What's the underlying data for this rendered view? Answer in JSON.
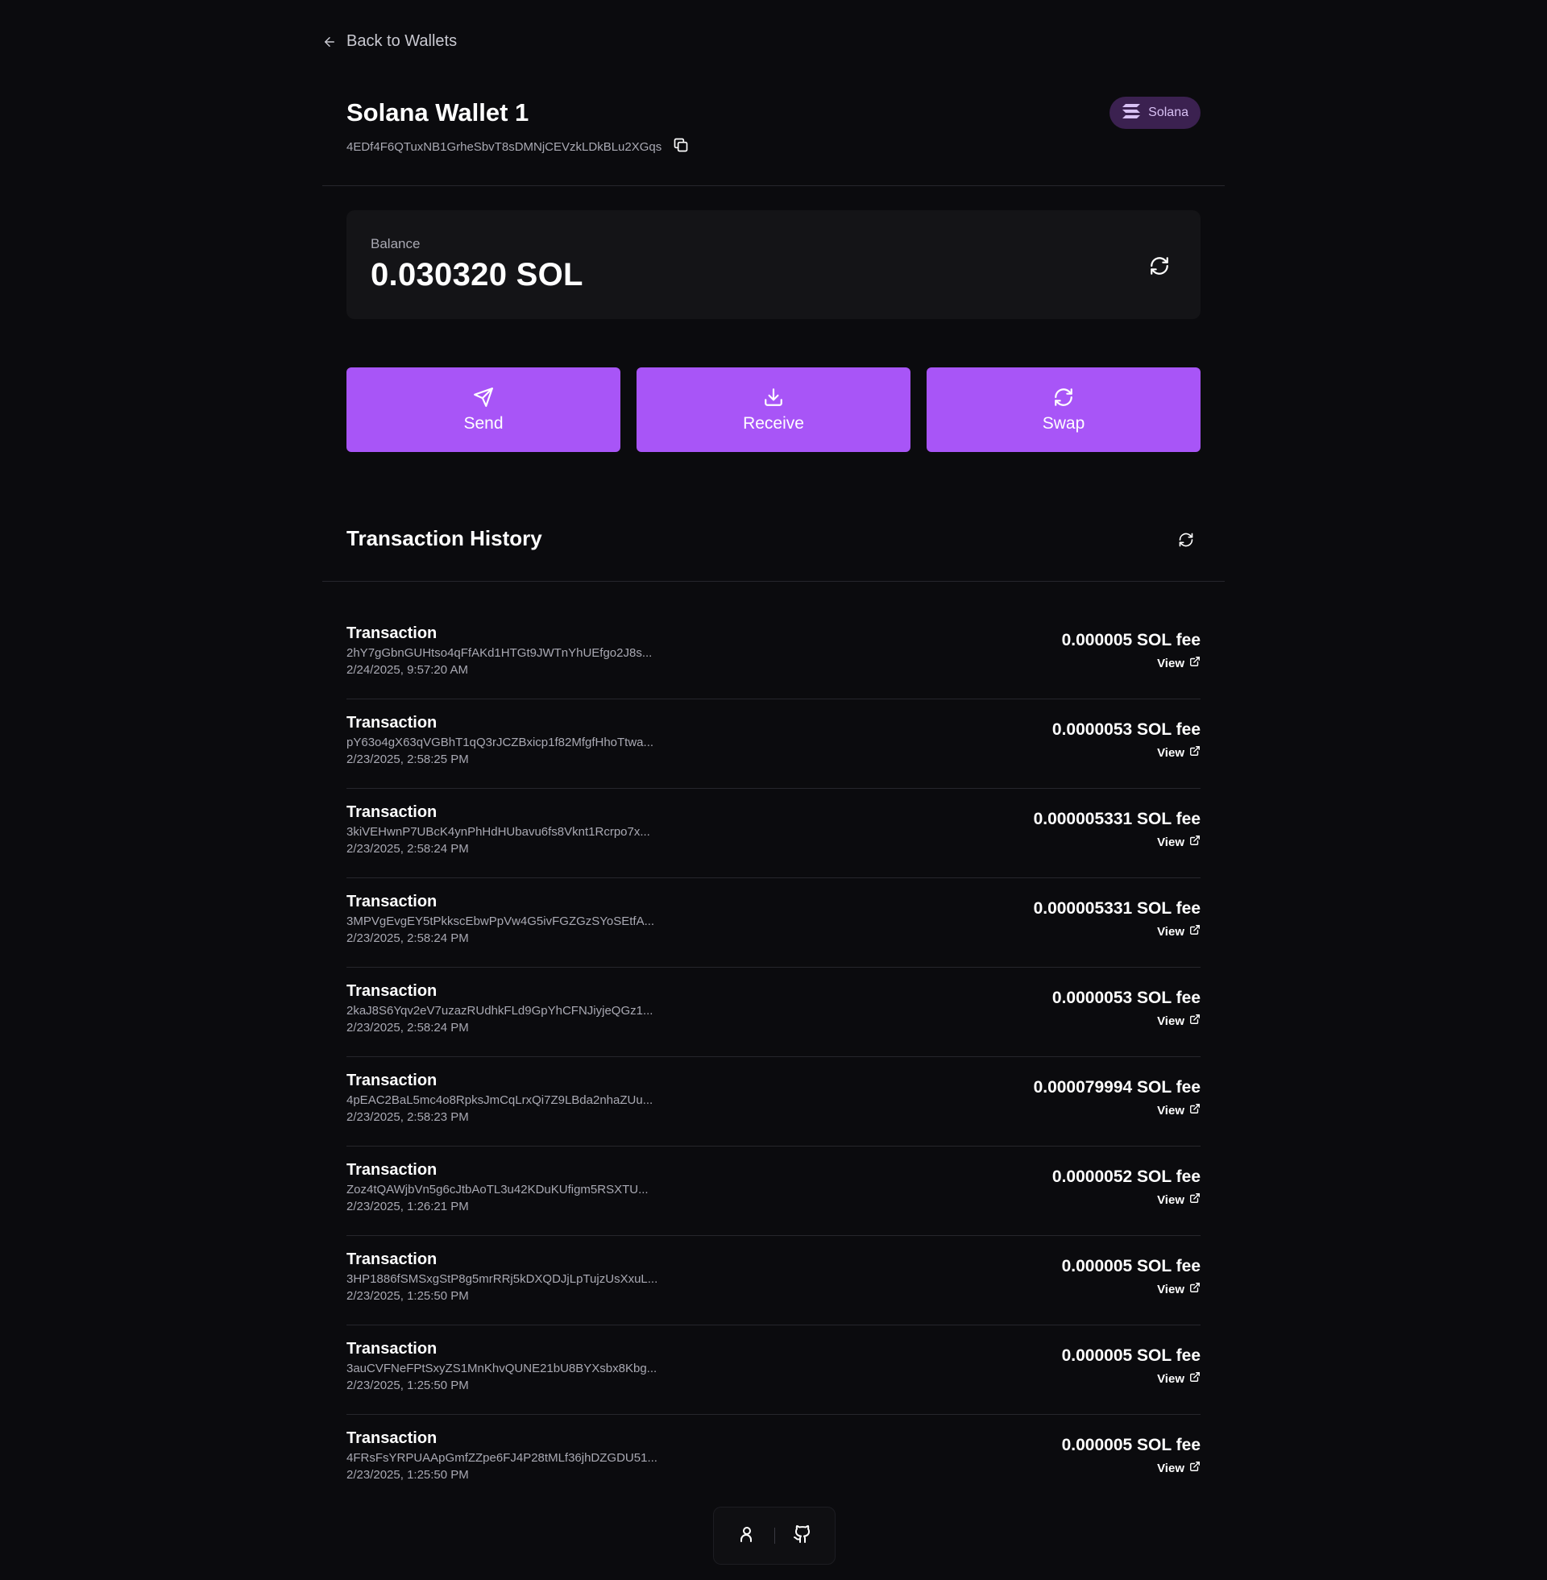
{
  "nav": {
    "back_label": "Back to Wallets"
  },
  "wallet": {
    "name": "Solana Wallet 1",
    "address": "4EDf4F6QTuxNB1GrheSbvT8sDMNjCEVzkLDkBLu2XGqs",
    "chain_badge": "Solana"
  },
  "balance": {
    "label": "Balance",
    "value": "0.030320 SOL"
  },
  "actions": {
    "send": "Send",
    "receive": "Receive",
    "swap": "Swap"
  },
  "history": {
    "title": "Transaction History",
    "view_label": "View",
    "transactions": [
      {
        "title": "Transaction",
        "signature": "2hY7gGbnGUHtso4qFfAKd1HTGt9JWTnYhUEfgo2J8s...",
        "date": "2/24/2025, 9:57:20 AM",
        "fee": "0.000005 SOL fee"
      },
      {
        "title": "Transaction",
        "signature": "pY63o4gX63qVGBhT1qQ3rJCZBxicp1f82MfgfHhoTtwa...",
        "date": "2/23/2025, 2:58:25 PM",
        "fee": "0.0000053 SOL fee"
      },
      {
        "title": "Transaction",
        "signature": "3kiVEHwnP7UBcK4ynPhHdHUbavu6fs8Vknt1Rcrpo7x...",
        "date": "2/23/2025, 2:58:24 PM",
        "fee": "0.000005331 SOL fee"
      },
      {
        "title": "Transaction",
        "signature": "3MPVgEvgEY5tPkkscEbwPpVw4G5ivFGZGzSYoSEtfA...",
        "date": "2/23/2025, 2:58:24 PM",
        "fee": "0.000005331 SOL fee"
      },
      {
        "title": "Transaction",
        "signature": "2kaJ8S6Yqv2eV7uzazRUdhkFLd9GpYhCFNJiyjeQGz1...",
        "date": "2/23/2025, 2:58:24 PM",
        "fee": "0.0000053 SOL fee"
      },
      {
        "title": "Transaction",
        "signature": "4pEAC2BaL5mc4o8RpksJmCqLrxQi7Z9LBda2nhaZUu...",
        "date": "2/23/2025, 2:58:23 PM",
        "fee": "0.000079994 SOL fee"
      },
      {
        "title": "Transaction",
        "signature": "Zoz4tQAWjbVn5g6cJtbAoTL3u42KDuKUfigm5RSXTU...",
        "date": "2/23/2025, 1:26:21 PM",
        "fee": "0.0000052 SOL fee"
      },
      {
        "title": "Transaction",
        "signature": "3HP1886fSMSxgStP8g5mrRRj5kDXQDJjLpTujzUsXxuL...",
        "date": "2/23/2025, 1:25:50 PM",
        "fee": "0.000005 SOL fee"
      },
      {
        "title": "Transaction",
        "signature": "3auCVFNeFPtSxyZS1MnKhvQUNE21bU8BYXsbx8Kbg...",
        "date": "2/23/2025, 1:25:50 PM",
        "fee": "0.000005 SOL fee"
      },
      {
        "title": "Transaction",
        "signature": "4FRsFsYRPUAApGmfZZpe6FJ4P28tMLf36jhDZGDU51...",
        "date": "2/23/2025, 1:25:50 PM",
        "fee": "0.000005 SOL fee"
      }
    ]
  },
  "icons": {
    "back": "arrow-left-icon",
    "copy": "copy-icon",
    "chain": "solana-logo-icon",
    "refresh": "refresh-icon",
    "send": "send-icon",
    "receive": "download-icon",
    "swap": "swap-icon",
    "external": "external-link-icon",
    "profile": "user-icon",
    "github": "github-icon"
  },
  "colors": {
    "background": "#0b0b0e",
    "card": "#141417",
    "accent": "#a855f7",
    "badge_bg": "#3b2150",
    "badge_text": "#d8c1f4",
    "muted_text": "#a9a9b3"
  }
}
